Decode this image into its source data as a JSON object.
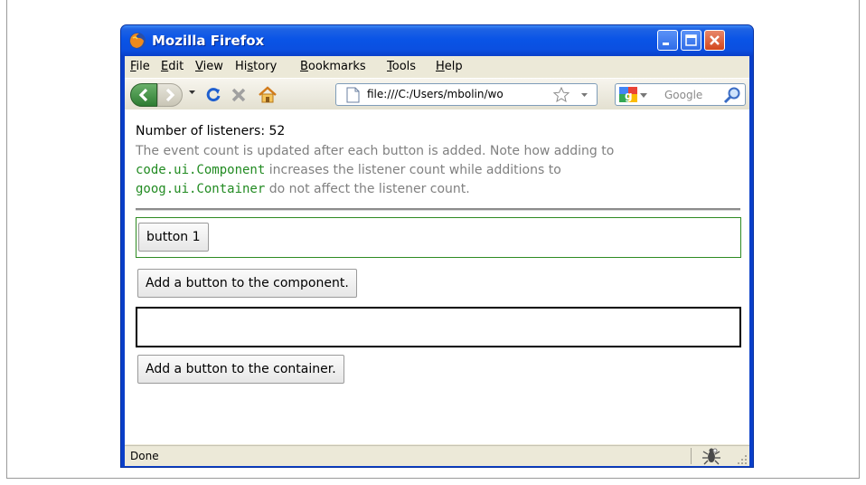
{
  "window": {
    "title": "Mozilla Firefox"
  },
  "menu": [
    {
      "label": "File",
      "key": "F",
      "rest": "ile"
    },
    {
      "label": "Edit",
      "key": "E",
      "rest": "dit"
    },
    {
      "label": "View",
      "key": "V",
      "rest": "iew"
    },
    {
      "label": "History",
      "pre": "Hi",
      "key": "s",
      "rest": "tory"
    },
    {
      "label": "Bookmarks",
      "key": "B",
      "rest": "ookmarks"
    },
    {
      "label": "Tools",
      "key": "T",
      "rest": "ools"
    },
    {
      "label": "Help",
      "key": "H",
      "rest": "elp"
    }
  ],
  "toolbar": {
    "url": "file:///C:/Users/mbolin/wo",
    "search_placeholder": "Google"
  },
  "content": {
    "listeners_text": "Number of listeners: 52",
    "desc_part1": "The event count is updated after each button is added. Note how adding to",
    "code1": "code.ui.Component",
    "desc_part2": " increases the listener count while additions to",
    "code2": "goog.ui.Container",
    "desc_part3": " do not affect the listener count.",
    "component_button": "button 1",
    "add_component_label": "Add a button to the component.",
    "add_container_label": "Add a button to the container."
  },
  "statusbar": {
    "text": "Done"
  },
  "colors": {
    "titlebar": "#0a54e6",
    "code": "#228b22",
    "component_border": "#2e8b22",
    "description": "#808080"
  }
}
